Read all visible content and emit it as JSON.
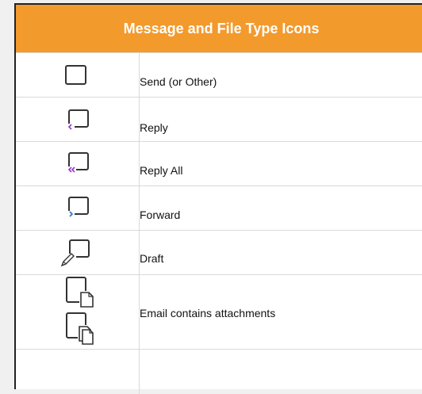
{
  "table": {
    "title": "Message and File Type Icons",
    "rows": [
      {
        "icon": "message-send-icon",
        "label": "Send (or Other)"
      },
      {
        "icon": "message-reply-icon",
        "label": "Reply"
      },
      {
        "icon": "message-reply-all-icon",
        "label": "Reply All"
      },
      {
        "icon": "message-forward-icon",
        "label": "Forward"
      },
      {
        "icon": "message-draft-icon",
        "label": "Draft"
      },
      {
        "icon": "message-attachment-icon",
        "label": "Email contains attachments"
      }
    ]
  },
  "colors": {
    "header_bg": "#f39a2c",
    "header_text": "#ffffff",
    "reply_arrow": "#9b34c9",
    "forward_arrow": "#2b6fd1",
    "border": "#d9d9d9"
  }
}
